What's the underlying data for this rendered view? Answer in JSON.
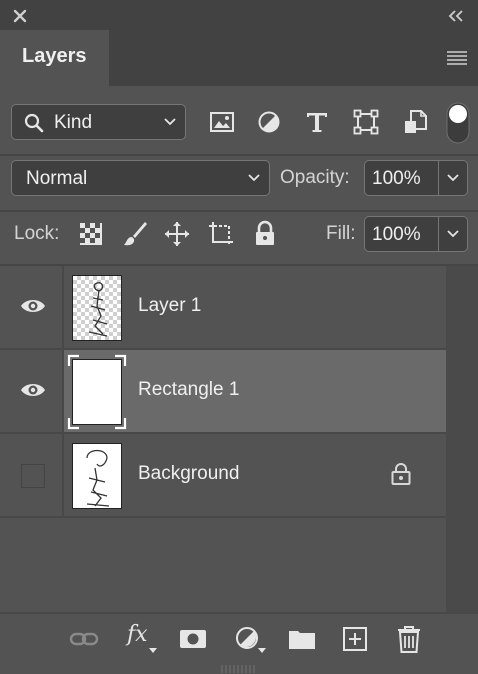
{
  "panel": {
    "tab_label": "Layers"
  },
  "filter": {
    "kind_label": "Kind"
  },
  "blend": {
    "mode": "Normal",
    "opacity_label": "Opacity:",
    "opacity_value": "100%"
  },
  "lock_row": {
    "lock_label": "Lock:",
    "fill_label": "Fill:",
    "fill_value": "100%"
  },
  "layers": [
    {
      "name": "Layer 1",
      "visible": true,
      "selected": false,
      "locked": false
    },
    {
      "name": "Rectangle 1",
      "visible": true,
      "selected": true,
      "locked": false
    },
    {
      "name": "Background",
      "visible": false,
      "selected": false,
      "locked": true
    }
  ],
  "bottom": {
    "fx_label": "fx"
  },
  "colors": {
    "panel_bg": "#535353",
    "header_bg": "#424242",
    "selected_row": "#6a6a6a",
    "text": "#f0f0f0"
  },
  "icons": [
    "close-icon",
    "collapse-icon",
    "panel-menu-icon",
    "search-icon",
    "image-filter-icon",
    "adjustment-filter-icon",
    "type-filter-icon",
    "shape-filter-icon",
    "smart-object-filter-icon",
    "filter-toggle",
    "lock-transparent-icon",
    "lock-brush-icon",
    "lock-move-icon",
    "lock-artboard-icon",
    "lock-all-icon",
    "eye-icon",
    "lock-icon",
    "link-icon",
    "fx-icon",
    "mask-icon",
    "adjustment-layer-icon",
    "folder-icon",
    "new-layer-icon",
    "trash-icon"
  ]
}
